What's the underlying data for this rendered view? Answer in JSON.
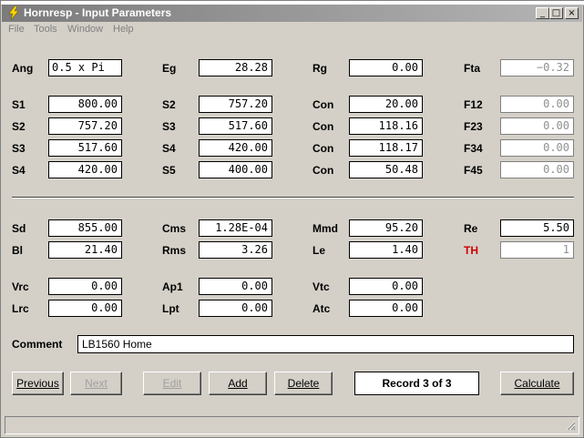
{
  "window": {
    "title": "Hornresp - Input Parameters"
  },
  "caption_buttons": {
    "minimize": "_",
    "maximize": "□",
    "close": "×"
  },
  "menu": [
    "File",
    "Tools",
    "Window",
    "Help"
  ],
  "top_section": {
    "rows": [
      [
        {
          "label": "Ang",
          "value": "0.5 x Pi"
        },
        {
          "label": "Eg",
          "value": "28.28"
        },
        {
          "label": "Rg",
          "value": "0.00"
        },
        {
          "label": "Fta",
          "value": "−0.32",
          "readonly": true
        }
      ],
      [
        {
          "label": "S1",
          "value": "800.00"
        },
        {
          "label": "S2",
          "value": "757.20"
        },
        {
          "label": "Con",
          "value": "20.00"
        },
        {
          "label": "F12",
          "value": "0.00",
          "readonly": true
        }
      ],
      [
        {
          "label": "S2",
          "value": "757.20"
        },
        {
          "label": "S3",
          "value": "517.60"
        },
        {
          "label": "Con",
          "value": "118.16"
        },
        {
          "label": "F23",
          "value": "0.00",
          "readonly": true
        }
      ],
      [
        {
          "label": "S3",
          "value": "517.60"
        },
        {
          "label": "S4",
          "value": "420.00"
        },
        {
          "label": "Con",
          "value": "118.17"
        },
        {
          "label": "F34",
          "value": "0.00",
          "readonly": true
        }
      ],
      [
        {
          "label": "S4",
          "value": "420.00"
        },
        {
          "label": "S5",
          "value": "400.00"
        },
        {
          "label": "Con",
          "value": "50.48"
        },
        {
          "label": "F45",
          "value": "0.00",
          "readonly": true
        }
      ]
    ]
  },
  "driver_section": {
    "rows": [
      [
        {
          "label": "Sd",
          "value": "855.00"
        },
        {
          "label": "Cms",
          "value": "1.28E-04"
        },
        {
          "label": "Mmd",
          "value": "95.20"
        },
        {
          "label": "Re",
          "value": "5.50"
        }
      ],
      [
        {
          "label": "Bl",
          "value": "21.40"
        },
        {
          "label": "Rms",
          "value": "3.26"
        },
        {
          "label": "Le",
          "value": "1.40"
        },
        {
          "label": "TH",
          "value": "1",
          "readonly": true
        }
      ],
      [
        {
          "label": "Vrc",
          "value": "0.00"
        },
        {
          "label": "Ap1",
          "value": "0.00"
        },
        {
          "label": "Vtc",
          "value": "0.00"
        }
      ],
      [
        {
          "label": "Lrc",
          "value": "0.00"
        },
        {
          "label": "Lpt",
          "value": "0.00"
        },
        {
          "label": "Atc",
          "value": "0.00"
        }
      ]
    ]
  },
  "comment": {
    "label": "Comment",
    "value": "LB1560 Home"
  },
  "buttons": {
    "previous": "Previous",
    "next": "Next",
    "edit": "Edit",
    "add": "Add",
    "delete": "Delete",
    "calculate": "Calculate"
  },
  "record": "Record 3 of 3",
  "colors": {
    "titlebar": "#7b7b7b",
    "face": "#d4d0c8",
    "th_label": "#d00000"
  }
}
